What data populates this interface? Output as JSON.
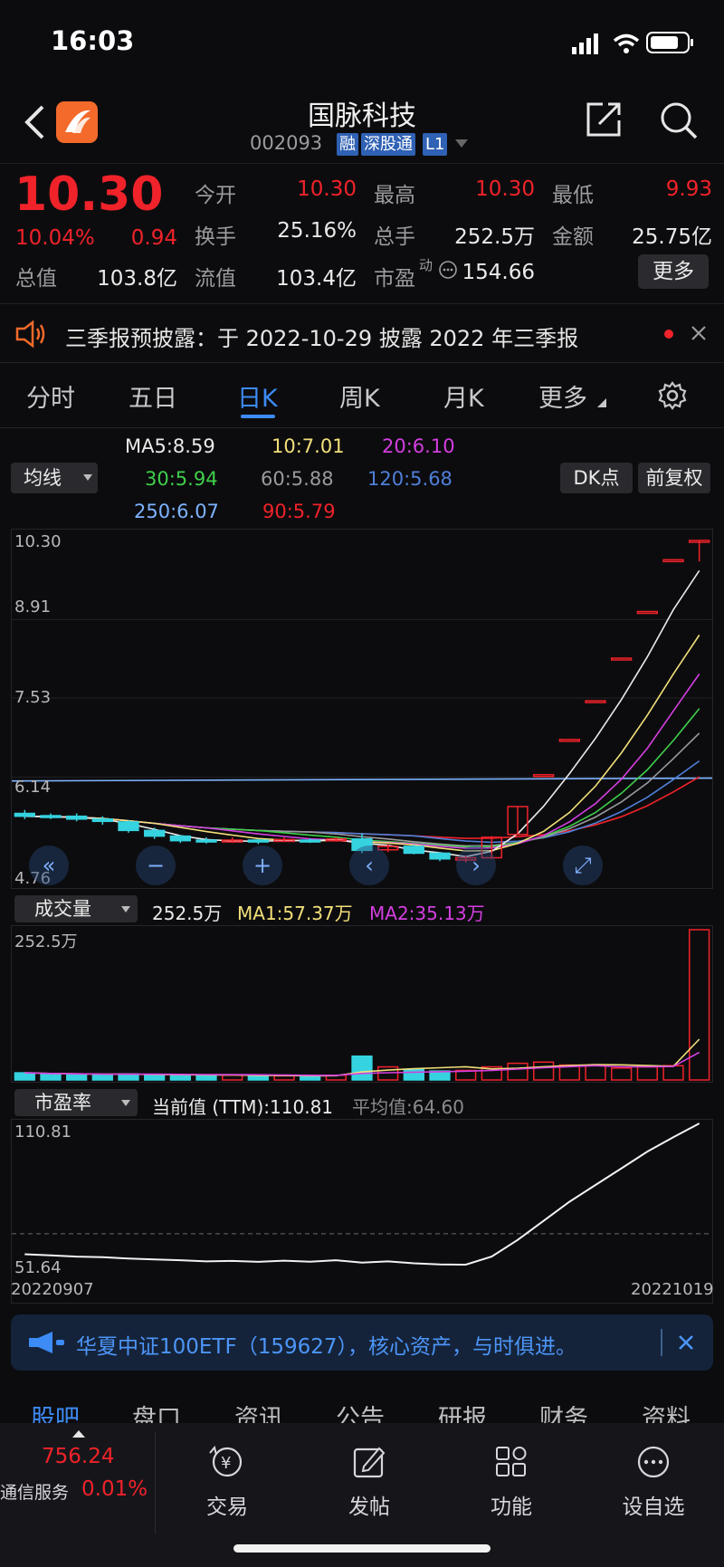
{
  "status_bar": {
    "time": "16:03"
  },
  "header": {
    "title": "国脉科技",
    "code": "002093",
    "badges": [
      "融",
      "深股通",
      "L1"
    ]
  },
  "quote": {
    "price": "10.30",
    "change_pct": "10.04%",
    "change": "0.94",
    "fields": [
      {
        "label": "今开",
        "value": "10.30",
        "color": "red"
      },
      {
        "label": "最高",
        "value": "10.30",
        "color": "red"
      },
      {
        "label": "最低",
        "value": "9.93",
        "color": "red"
      },
      {
        "label": "换手",
        "value": "25.16%",
        "color": "white"
      },
      {
        "label": "总手",
        "value": "252.5万",
        "color": "white"
      },
      {
        "label": "金额",
        "value": "25.75亿",
        "color": "white"
      },
      {
        "label": "总值",
        "value": "103.8亿",
        "color": "white"
      },
      {
        "label": "流值",
        "value": "103.4亿",
        "color": "white"
      },
      {
        "label": "市盈",
        "value": "154.66",
        "color": "white"
      }
    ],
    "pe_superscript": "动",
    "more_button": "更多"
  },
  "notice": {
    "text": "三季报预披露：于 2022-10-29 披露 2022 年三季报"
  },
  "tabs": [
    "分时",
    "五日",
    "日K",
    "周K",
    "月K",
    "更多"
  ],
  "active_tab": "日K",
  "ma_selector": "均线",
  "ma_values": [
    {
      "text": "MA5:8.59",
      "color": "#eaeaea"
    },
    {
      "text": "10:7.01",
      "color": "#f3e07a"
    },
    {
      "text": "20:6.10",
      "color": "#d43fe0"
    },
    {
      "text": "30:5.94",
      "color": "#3fcf4a"
    },
    {
      "text": "60:5.88",
      "color": "#9a9a9e"
    },
    {
      "text": "120:5.68",
      "color": "#4f7fd8"
    },
    {
      "text": "250:6.07",
      "color": "#7db3ff"
    },
    {
      "text": "90:5.79",
      "color": "#f0222a"
    }
  ],
  "chips": {
    "dk": "DK点",
    "fq": "前复权"
  },
  "price_axis": [
    "10.30",
    "8.91",
    "7.53",
    "6.14",
    "4.76"
  ],
  "volume": {
    "selector": "成交量",
    "current": "252.5万",
    "ma1": "MA1:57.37万",
    "ma2": "MA2:35.13万",
    "axis_top": "252.5万"
  },
  "pe": {
    "selector": "市盈率",
    "current": "当前值 (TTM):110.81",
    "average": "平均值:64.60",
    "axis_top": "110.81",
    "axis_bottom": "51.64"
  },
  "dates": {
    "start": "20220907",
    "end": "20221019"
  },
  "banner": {
    "text": "华夏中证100ETF（159627），核心资产，与时俱进。"
  },
  "bottom_tabs": [
    "股吧",
    "盘口",
    "资讯",
    "公告",
    "研报",
    "财务",
    "资料"
  ],
  "bottom_bar": {
    "index_value": "756.24",
    "index_name": "通信服务",
    "index_change": "0.01%",
    "items": [
      "交易",
      "发帖",
      "功能",
      "设自选"
    ]
  },
  "chart_data": {
    "type": "candlestick",
    "x_range": [
      "20220907",
      "20221019"
    ],
    "ylim": [
      4.76,
      10.3
    ],
    "candles": [
      {
        "o": 5.5,
        "c": 5.45,
        "h": 5.56,
        "l": 5.4
      },
      {
        "o": 5.46,
        "c": 5.44,
        "h": 5.5,
        "l": 5.4
      },
      {
        "o": 5.45,
        "c": 5.4,
        "h": 5.5,
        "l": 5.36
      },
      {
        "o": 5.4,
        "c": 5.36,
        "h": 5.45,
        "l": 5.3
      },
      {
        "o": 5.35,
        "c": 5.2,
        "h": 5.38,
        "l": 5.16
      },
      {
        "o": 5.2,
        "c": 5.1,
        "h": 5.25,
        "l": 5.05
      },
      {
        "o": 5.1,
        "c": 5.02,
        "h": 5.12,
        "l": 4.98
      },
      {
        "o": 5.03,
        "c": 5.0,
        "h": 5.08,
        "l": 4.97
      },
      {
        "o": 5.01,
        "c": 5.03,
        "h": 5.08,
        "l": 4.98
      },
      {
        "o": 5.03,
        "c": 5.0,
        "h": 5.05,
        "l": 4.96
      },
      {
        "o": 5.02,
        "c": 5.04,
        "h": 5.08,
        "l": 5.0
      },
      {
        "o": 5.03,
        "c": 5.02,
        "h": 5.06,
        "l": 4.98
      },
      {
        "o": 5.02,
        "c": 5.05,
        "h": 5.08,
        "l": 5.0
      },
      {
        "o": 5.05,
        "c": 4.85,
        "h": 5.15,
        "l": 4.8
      },
      {
        "o": 4.86,
        "c": 4.92,
        "h": 4.96,
        "l": 4.82
      },
      {
        "o": 4.92,
        "c": 4.8,
        "h": 4.95,
        "l": 4.78
      },
      {
        "o": 4.8,
        "c": 4.7,
        "h": 4.82,
        "l": 4.66
      },
      {
        "o": 4.68,
        "c": 4.72,
        "h": 4.76,
        "l": 4.64
      },
      {
        "o": 4.72,
        "c": 5.08,
        "h": 5.1,
        "l": 4.7
      },
      {
        "o": 5.13,
        "c": 5.62,
        "h": 5.62,
        "l": 5.13
      },
      {
        "o": 6.18,
        "c": 6.18,
        "h": 6.18,
        "l": 6.18
      },
      {
        "o": 6.8,
        "c": 6.8,
        "h": 6.8,
        "l": 6.8
      },
      {
        "o": 7.48,
        "c": 7.48,
        "h": 7.48,
        "l": 7.48
      },
      {
        "o": 8.23,
        "c": 8.23,
        "h": 8.23,
        "l": 8.23
      },
      {
        "o": 9.05,
        "c": 9.05,
        "h": 9.05,
        "l": 9.05
      },
      {
        "o": 9.96,
        "c": 9.96,
        "h": 9.96,
        "l": 9.96
      },
      {
        "o": 10.3,
        "c": 10.3,
        "h": 10.3,
        "l": 9.93
      }
    ],
    "volume": [
      12,
      10,
      9,
      8,
      10,
      9,
      8,
      7,
      8,
      7,
      7,
      6,
      8,
      40,
      22,
      18,
      15,
      16,
      22,
      28,
      30,
      25,
      24,
      20,
      22,
      24,
      252.5
    ],
    "pe": [
      56,
      55.5,
      55,
      54.8,
      54.2,
      53.8,
      53.5,
      53.0,
      53.2,
      52.8,
      53.3,
      52.9,
      53.5,
      52.5,
      53.0,
      52.2,
      51.7,
      51.64,
      55,
      62,
      70,
      78,
      85,
      92,
      99,
      105,
      110.81
    ]
  }
}
